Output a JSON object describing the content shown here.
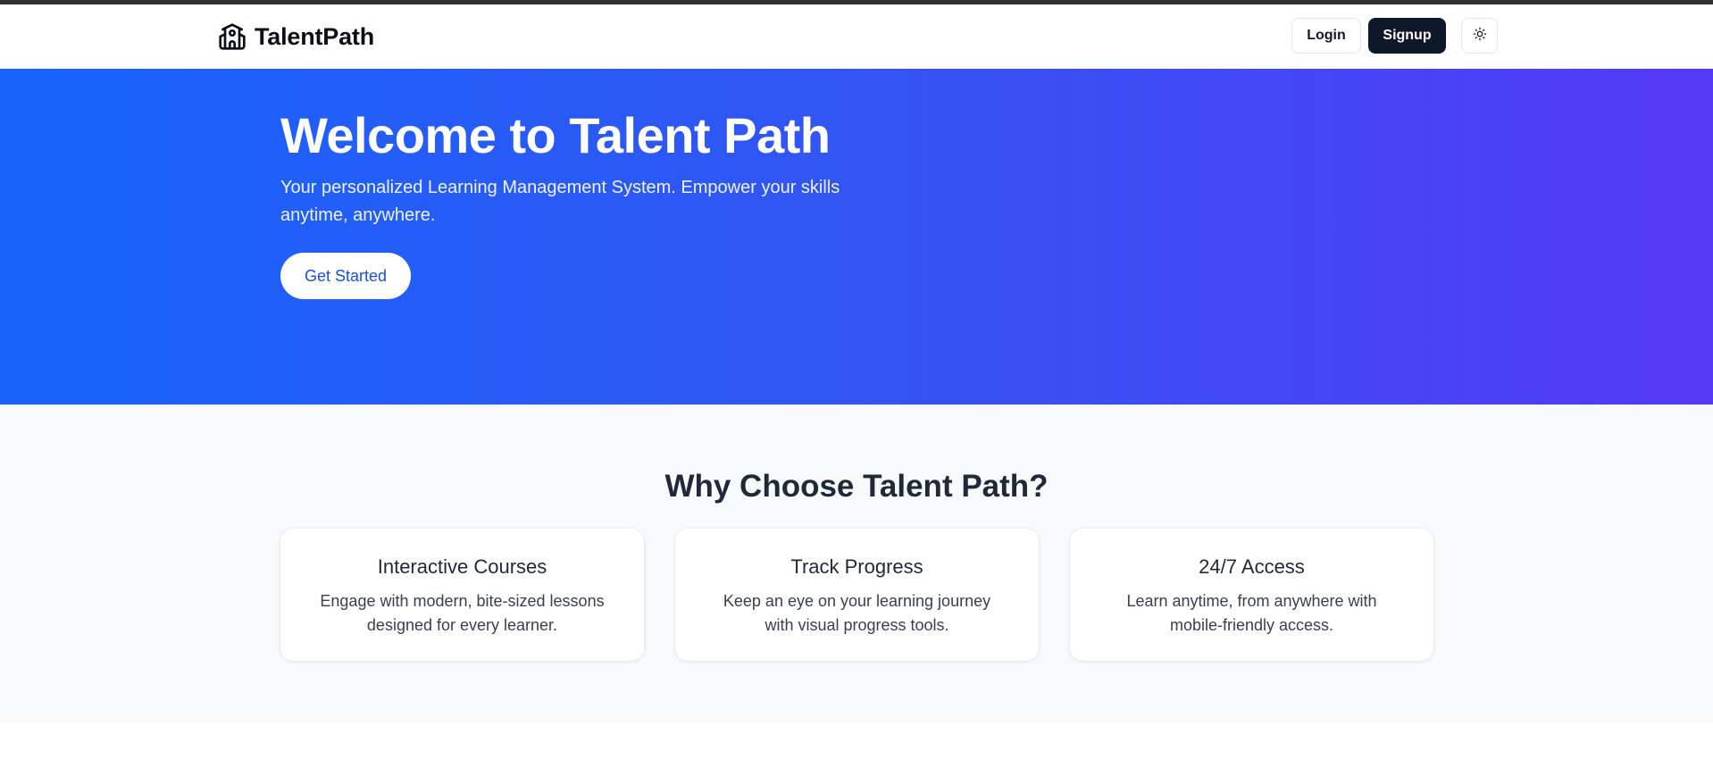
{
  "nav": {
    "brand_icon": "school-building-icon",
    "brand_name": "TalentPath",
    "login_label": "Login",
    "signup_label": "Signup",
    "theme_icon": "sun-icon"
  },
  "hero": {
    "title": "Welcome to Talent Path",
    "subtitle": "Your personalized Learning Management System. Empower your skills anytime, anywhere.",
    "cta_label": "Get Started",
    "gradient_start": "#1764fb",
    "gradient_end": "#5439f6"
  },
  "features": {
    "title": "Why Choose Talent Path?",
    "cards": [
      {
        "title": "Interactive Courses",
        "description": "Engage with modern, bite-sized lessons designed for every learner."
      },
      {
        "title": "Track Progress",
        "description": "Keep an eye on your learning journey with visual progress tools."
      },
      {
        "title": "24/7 Access",
        "description": "Learn anytime, from anywhere with mobile-friendly access."
      }
    ]
  },
  "colors": {
    "primary_dark": "#0f172a",
    "accent_blue": "#1d4ed8",
    "section_bg": "#f8f9fb"
  }
}
